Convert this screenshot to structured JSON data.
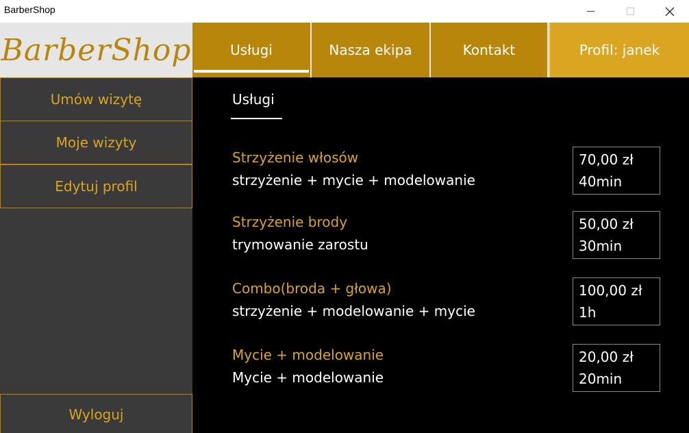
{
  "window": {
    "title": "BarberShop"
  },
  "header": {
    "logo": "BarberShop",
    "tabs": [
      {
        "label": "Usługi"
      },
      {
        "label": "Nasza ekipa"
      },
      {
        "label": "Kontakt"
      }
    ],
    "profile_label": "Profil: janek"
  },
  "sidebar": {
    "items": [
      {
        "label": "Umów wizytę"
      },
      {
        "label": "Moje wizyty"
      },
      {
        "label": "Edytuj profil"
      }
    ],
    "logout_label": "Wyloguj"
  },
  "main": {
    "title": "Usługi",
    "services": [
      {
        "name": "Strzyżenie włosów",
        "description": "strzyżenie + mycie + modelowanie",
        "price": "70,00 zł",
        "duration": "40min"
      },
      {
        "name": "Strzyżenie brody",
        "description": "trymowanie zarostu",
        "price": "50,00 zł",
        "duration": "30min"
      },
      {
        "name": "Combo(broda + głowa)",
        "description": "strzyżenie + modelowanie + mycie",
        "price": "100,00 zł",
        "duration": "1h"
      },
      {
        "name": "Mycie + modelowanie",
        "description": "Mycie + modelowanie",
        "price": "20,00 zł",
        "duration": "20min"
      }
    ]
  },
  "colors": {
    "accent": "#b8860b",
    "profile": "#daa520",
    "sidebar": "#3a3a3a",
    "background": "#000000"
  }
}
